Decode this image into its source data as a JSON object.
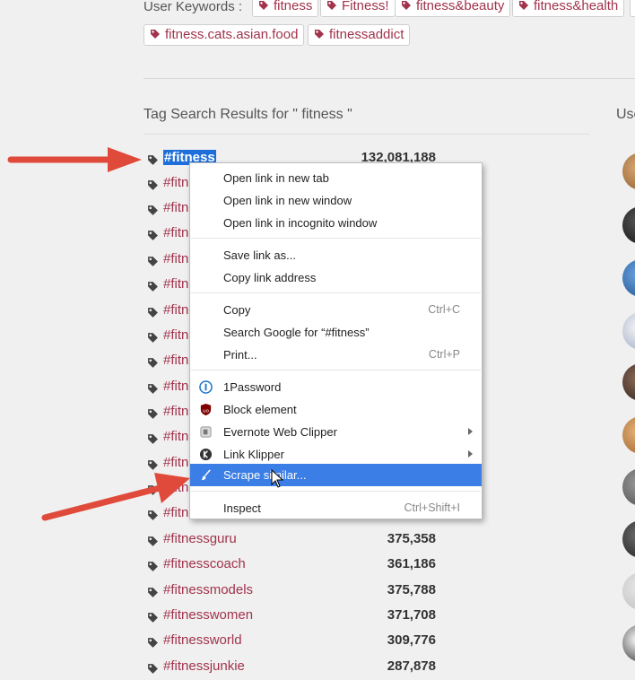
{
  "keywords": {
    "label": "User Keywords :",
    "tags": [
      "fitness",
      "Fitness!",
      "fitness&beauty",
      "fitness&health",
      "fitness.cats.asian.food",
      "fitnessaddict"
    ]
  },
  "section_title": "Tag Search Results for \" fitness \"",
  "users_title": "Use",
  "rows": [
    {
      "tag": "#fitness",
      "count": "132,081,188"
    },
    {
      "tag": "#fitn",
      "count": ""
    },
    {
      "tag": "#fitn",
      "count": ""
    },
    {
      "tag": "#fitn",
      "count": ""
    },
    {
      "tag": "#fitn",
      "count": ""
    },
    {
      "tag": "#fitn",
      "count": ""
    },
    {
      "tag": "#fitn",
      "count": ""
    },
    {
      "tag": "#fitn",
      "count": ""
    },
    {
      "tag": "#fitn",
      "count": ""
    },
    {
      "tag": "#fitn",
      "count": ""
    },
    {
      "tag": "#fitn",
      "count": ""
    },
    {
      "tag": "#fitn",
      "count": ""
    },
    {
      "tag": "#fitn",
      "count": ""
    },
    {
      "tag": "#fitn",
      "count": ""
    },
    {
      "tag": "#fitn",
      "count": ""
    },
    {
      "tag": "#fitnessguru",
      "count": "375,358"
    },
    {
      "tag": "#fitnesscoach",
      "count": "361,186"
    },
    {
      "tag": "#fitnessmodels",
      "count": "375,788"
    },
    {
      "tag": "#fitnesswomen",
      "count": "371,708"
    },
    {
      "tag": "#fitnessworld",
      "count": "309,776"
    },
    {
      "tag": "#fitnessjunkie",
      "count": "287,878"
    }
  ],
  "context_menu": {
    "items": [
      {
        "label": "Open link in new tab"
      },
      {
        "label": "Open link in new window"
      },
      {
        "label": "Open link in incognito window"
      },
      {
        "label": "Save link as..."
      },
      {
        "label": "Copy link address"
      },
      {
        "label": "Copy",
        "shortcut": "Ctrl+C"
      },
      {
        "label": "Search Google for “#fitness”"
      },
      {
        "label": "Print...",
        "shortcut": "Ctrl+P"
      },
      {
        "label": "1Password",
        "icon": "1password-icon"
      },
      {
        "label": "Block element",
        "icon": "ublock-origin-icon"
      },
      {
        "label": "Evernote Web Clipper",
        "icon": "evernote-icon",
        "submenu": true
      },
      {
        "label": "Link Klipper",
        "icon": "link-klipper-icon",
        "submenu": true
      },
      {
        "label": "Scrape similar...",
        "icon": "scraper-brush-icon",
        "highlighted": true
      },
      {
        "label": "Inspect",
        "shortcut": "Ctrl+Shift+I"
      }
    ]
  },
  "colors": {
    "tag_text": "#a1334c",
    "selection": "#1e6fd9",
    "menu_highlight": "#3b7ee6",
    "arrow": "#e04a3a"
  }
}
